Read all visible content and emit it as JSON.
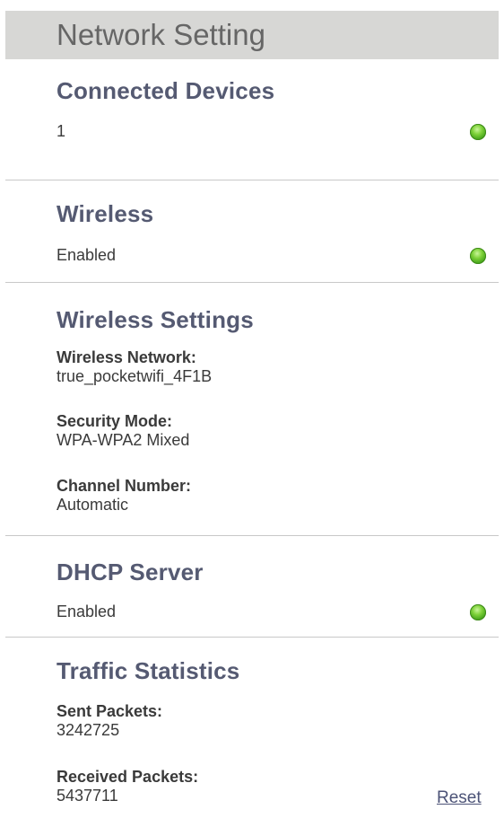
{
  "header": {
    "title": "Network Setting"
  },
  "connected_devices": {
    "title": "Connected Devices",
    "count": "1",
    "status_color": "#5cbf2a"
  },
  "wireless": {
    "title": "Wireless",
    "status": "Enabled",
    "status_color": "#5cbf2a"
  },
  "wireless_settings": {
    "title": "Wireless Settings",
    "network_label": "Wireless Network:",
    "network_value": "true_pocketwifi_4F1B",
    "security_label": "Security Mode:",
    "security_value": "WPA-WPA2 Mixed",
    "channel_label": "Channel Number:",
    "channel_value": "Automatic"
  },
  "dhcp_server": {
    "title": "DHCP Server",
    "status": "Enabled",
    "status_color": "#5cbf2a"
  },
  "traffic_statistics": {
    "title": "Traffic Statistics",
    "sent_label": "Sent Packets:",
    "sent_value": "3242725",
    "received_label": "Received Packets:",
    "received_value": "5437711",
    "reset_label": "Reset"
  }
}
